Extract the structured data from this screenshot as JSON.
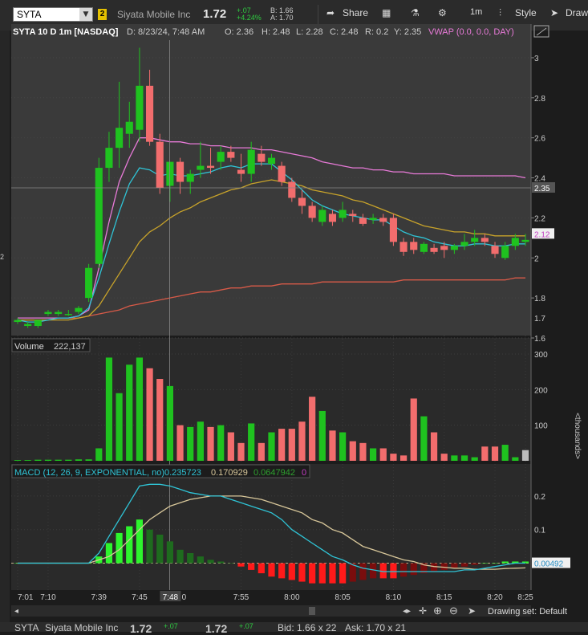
{
  "topbar": {
    "symbol": "SYTA",
    "link_number": "2",
    "company": "Siyata Mobile Inc",
    "last": "1.72",
    "net_change": "+.07",
    "pct_change": "+4.24%",
    "bid": "B: 1.66",
    "ask": "A: 1.70",
    "share_label": "Share",
    "interval_label": "1m",
    "style_label": "Style",
    "drawings_label": "Drawings"
  },
  "header": {
    "title": "SYTA 10 D 1m [NASDAQ]",
    "date": "D: 8/23/24, 7:48 AM",
    "open": "O: 2.36",
    "high": "H: 2.48",
    "low": "L: 2.28",
    "close": "C: 2.48",
    "range": "R: 0.2",
    "y": "Y: 2.35",
    "vwap": "VWAP (0.0, 0.0, DAY)"
  },
  "volume_header": {
    "label": "Volume",
    "value": "222,137"
  },
  "macd_header": {
    "label": "MACD (12, 26, 9, EXPONENTIAL, no)",
    "value": "0.235723",
    "avg": "0.170929",
    "diff": "0.0647942",
    "zero": "0"
  },
  "price_axis": {
    "ticks": [
      "3",
      "2.8",
      "2.6",
      "2.4",
      "2.2",
      "2",
      "1.8",
      "1.6"
    ],
    "cursor_label": "2.35",
    "last_label": "2.12",
    "low_label": "1.7",
    "left_tick": "2"
  },
  "volume_axis": {
    "ticks": [
      "300",
      "200",
      "100"
    ],
    "unit": "<thousands>"
  },
  "macd_axis": {
    "ticks": [
      "0.2",
      "0.1"
    ],
    "value_label": "0.00492"
  },
  "time_axis": {
    "ticks": [
      "7:01",
      "7:10",
      "7:39",
      "7:45",
      "7:55",
      "8:00",
      "8:05",
      "8:10",
      "8:15",
      "8:20",
      "8:25"
    ],
    "cursor_label": "7:48",
    "cursor_tail": "0"
  },
  "bottom": {
    "drawing_set": "Drawing set: Default"
  },
  "footer": {
    "symbol": "SYTA",
    "company": "Siyata Mobile Inc",
    "last": "1.72",
    "change": "+.07",
    "last2": "1.72",
    "change2": "+.07",
    "bid": "Bid: 1.66 x 22",
    "ask": "Ask: 1.70 x 21"
  },
  "colors": {
    "up": "#1fc21f",
    "down": "#f26d6d",
    "vwap": "#e87ad8",
    "ema_fast": "#2fc4d6",
    "ema_mid": "#c8a32a",
    "ema_slow": "#d85a48",
    "macd": "#2fc4d6",
    "macd_avg": "#d8c79a"
  },
  "chart_data": {
    "type": "candlestick",
    "title": "SYTA 10 D 1m [NASDAQ]",
    "ylim": [
      1.6,
      3.1
    ],
    "candles": [
      {
        "t": "7:01",
        "o": 1.68,
        "h": 1.7,
        "l": 1.67,
        "c": 1.69
      },
      {
        "t": "7:36",
        "o": 1.66,
        "h": 1.68,
        "l": 1.65,
        "c": 1.67
      },
      {
        "t": "7:37",
        "o": 1.66,
        "h": 1.69,
        "l": 1.65,
        "c": 1.69
      },
      {
        "t": "7:38",
        "o": 1.72,
        "h": 1.74,
        "l": 1.71,
        "c": 1.73
      },
      {
        "t": "7:39",
        "o": 1.72,
        "h": 1.74,
        "l": 1.71,
        "c": 1.73
      },
      {
        "t": "7:40",
        "o": 1.72,
        "h": 1.74,
        "l": 1.71,
        "c": 1.72
      },
      {
        "t": "7:41",
        "o": 1.73,
        "h": 1.76,
        "l": 1.72,
        "c": 1.75
      },
      {
        "t": "7:42",
        "o": 1.8,
        "h": 1.97,
        "l": 1.78,
        "c": 1.95
      },
      {
        "t": "7:43",
        "o": 1.97,
        "h": 2.5,
        "l": 1.95,
        "c": 2.45
      },
      {
        "t": "7:44",
        "o": 2.45,
        "h": 2.63,
        "l": 2.38,
        "c": 2.55
      },
      {
        "t": "7:45",
        "o": 2.55,
        "h": 2.88,
        "l": 2.45,
        "c": 2.65
      },
      {
        "t": "7:46",
        "o": 2.62,
        "h": 2.78,
        "l": 2.55,
        "c": 2.68
      },
      {
        "t": "7:47",
        "o": 2.64,
        "h": 3.05,
        "l": 2.58,
        "c": 2.86
      },
      {
        "t": "7:48",
        "o": 2.86,
        "h": 2.94,
        "l": 2.56,
        "c": 2.58
      },
      {
        "t": "7:49",
        "o": 2.58,
        "h": 2.62,
        "l": 2.32,
        "c": 2.35
      },
      {
        "t": "7:50",
        "o": 2.36,
        "h": 2.48,
        "l": 2.28,
        "c": 2.48
      },
      {
        "t": "7:51",
        "o": 2.48,
        "h": 2.5,
        "l": 2.32,
        "c": 2.38
      },
      {
        "t": "7:52",
        "o": 2.38,
        "h": 2.44,
        "l": 2.32,
        "c": 2.42
      },
      {
        "t": "7:53",
        "o": 2.44,
        "h": 2.58,
        "l": 2.4,
        "c": 2.46
      },
      {
        "t": "7:54",
        "o": 2.46,
        "h": 2.55,
        "l": 2.42,
        "c": 2.45
      },
      {
        "t": "7:55",
        "o": 2.48,
        "h": 2.56,
        "l": 2.44,
        "c": 2.53
      },
      {
        "t": "7:56",
        "o": 2.53,
        "h": 2.56,
        "l": 2.48,
        "c": 2.5
      },
      {
        "t": "7:57",
        "o": 2.44,
        "h": 2.52,
        "l": 2.38,
        "c": 2.42
      },
      {
        "t": "7:58",
        "o": 2.42,
        "h": 2.58,
        "l": 2.38,
        "c": 2.54
      },
      {
        "t": "7:59",
        "o": 2.52,
        "h": 2.56,
        "l": 2.46,
        "c": 2.48
      },
      {
        "t": "8:00",
        "o": 2.47,
        "h": 2.52,
        "l": 2.44,
        "c": 2.5
      },
      {
        "t": "8:01",
        "o": 2.46,
        "h": 2.48,
        "l": 2.36,
        "c": 2.38
      },
      {
        "t": "8:02",
        "o": 2.38,
        "h": 2.4,
        "l": 2.28,
        "c": 2.3
      },
      {
        "t": "8:03",
        "o": 2.3,
        "h": 2.34,
        "l": 2.22,
        "c": 2.26
      },
      {
        "t": "8:04",
        "o": 2.26,
        "h": 2.28,
        "l": 2.18,
        "c": 2.2
      },
      {
        "t": "8:05",
        "o": 2.18,
        "h": 2.26,
        "l": 2.16,
        "c": 2.24
      },
      {
        "t": "8:06",
        "o": 2.22,
        "h": 2.24,
        "l": 2.16,
        "c": 2.18
      },
      {
        "t": "8:07",
        "o": 2.2,
        "h": 2.28,
        "l": 2.18,
        "c": 2.24
      },
      {
        "t": "8:08",
        "o": 2.22,
        "h": 2.24,
        "l": 2.18,
        "c": 2.21
      },
      {
        "t": "8:09",
        "o": 2.2,
        "h": 2.22,
        "l": 2.16,
        "c": 2.17
      },
      {
        "t": "8:10",
        "o": 2.19,
        "h": 2.22,
        "l": 2.17,
        "c": 2.2
      },
      {
        "t": "8:11",
        "o": 2.2,
        "h": 2.22,
        "l": 2.16,
        "c": 2.18
      },
      {
        "t": "8:12",
        "o": 2.2,
        "h": 2.22,
        "l": 2.06,
        "c": 2.08
      },
      {
        "t": "8:13",
        "o": 2.08,
        "h": 2.1,
        "l": 2.01,
        "c": 2.03
      },
      {
        "t": "8:14",
        "o": 2.08,
        "h": 2.1,
        "l": 2.02,
        "c": 2.04
      },
      {
        "t": "8:15",
        "o": 2.03,
        "h": 2.08,
        "l": 2.02,
        "c": 2.07
      },
      {
        "t": "8:16",
        "o": 2.05,
        "h": 2.07,
        "l": 2.02,
        "c": 2.03
      },
      {
        "t": "8:17",
        "o": 2.06,
        "h": 2.08,
        "l": 2.0,
        "c": 2.04
      },
      {
        "t": "8:18",
        "o": 2.04,
        "h": 2.07,
        "l": 2.02,
        "c": 2.06
      },
      {
        "t": "8:19",
        "o": 2.06,
        "h": 2.12,
        "l": 2.04,
        "c": 2.08
      },
      {
        "t": "8:20",
        "o": 2.08,
        "h": 2.14,
        "l": 2.06,
        "c": 2.1
      },
      {
        "t": "8:21",
        "o": 2.1,
        "h": 2.12,
        "l": 2.06,
        "c": 2.08
      },
      {
        "t": "8:22",
        "o": 2.06,
        "h": 2.08,
        "l": 2.0,
        "c": 2.02
      },
      {
        "t": "8:23",
        "o": 2.0,
        "h": 2.08,
        "l": 1.99,
        "c": 2.06
      },
      {
        "t": "8:24",
        "o": 2.06,
        "h": 2.12,
        "l": 2.04,
        "c": 2.1
      },
      {
        "t": "8:25",
        "o": 2.08,
        "h": 2.12,
        "l": 2.06,
        "c": 2.09
      }
    ],
    "vwap": [
      1.7,
      1.7,
      1.7,
      1.7,
      1.7,
      1.7,
      1.71,
      1.74,
      1.95,
      2.18,
      2.38,
      2.5,
      2.6,
      2.6,
      2.59,
      2.58,
      2.58,
      2.57,
      2.57,
      2.56,
      2.56,
      2.55,
      2.55,
      2.55,
      2.54,
      2.54,
      2.53,
      2.52,
      2.51,
      2.5,
      2.48,
      2.47,
      2.46,
      2.45,
      2.45,
      2.44,
      2.44,
      2.43,
      2.43,
      2.42,
      2.42,
      2.42,
      2.42,
      2.41,
      2.41,
      2.41,
      2.41,
      2.41,
      2.41,
      2.41,
      2.4
    ],
    "ema_fast": [
      1.69,
      1.68,
      1.68,
      1.69,
      1.7,
      1.7,
      1.71,
      1.75,
      1.9,
      2.07,
      2.23,
      2.37,
      2.45,
      2.44,
      2.41,
      2.42,
      2.41,
      2.41,
      2.42,
      2.43,
      2.45,
      2.46,
      2.45,
      2.47,
      2.47,
      2.47,
      2.43,
      2.39,
      2.34,
      2.29,
      2.26,
      2.24,
      2.22,
      2.21,
      2.2,
      2.19,
      2.19,
      2.16,
      2.13,
      2.11,
      2.1,
      2.08,
      2.07,
      2.06,
      2.06,
      2.07,
      2.07,
      2.06,
      2.06,
      2.07,
      2.07
    ],
    "ema_mid": [
      1.69,
      1.69,
      1.69,
      1.69,
      1.69,
      1.69,
      1.7,
      1.71,
      1.76,
      1.84,
      1.92,
      2.0,
      2.08,
      2.13,
      2.16,
      2.2,
      2.23,
      2.25,
      2.28,
      2.3,
      2.32,
      2.34,
      2.35,
      2.37,
      2.38,
      2.39,
      2.38,
      2.37,
      2.36,
      2.34,
      2.33,
      2.32,
      2.31,
      2.29,
      2.28,
      2.26,
      2.24,
      2.22,
      2.2,
      2.18,
      2.16,
      2.15,
      2.14,
      2.13,
      2.13,
      2.12,
      2.12,
      2.11,
      2.11,
      2.11,
      2.11
    ],
    "ema_slow": [
      1.69,
      1.69,
      1.69,
      1.69,
      1.7,
      1.7,
      1.7,
      1.71,
      1.72,
      1.73,
      1.74,
      1.76,
      1.77,
      1.78,
      1.79,
      1.8,
      1.81,
      1.82,
      1.83,
      1.83,
      1.84,
      1.85,
      1.85,
      1.86,
      1.86,
      1.86,
      1.87,
      1.87,
      1.87,
      1.87,
      1.88,
      1.88,
      1.88,
      1.88,
      1.88,
      1.88,
      1.88,
      1.88,
      1.89,
      1.89,
      1.89,
      1.89,
      1.89,
      1.89,
      1.89,
      1.89,
      1.89,
      1.89,
      1.89,
      1.9,
      1.9
    ],
    "volume": [
      2,
      2,
      3,
      3,
      3,
      3,
      4,
      4,
      35,
      290,
      190,
      270,
      290,
      260,
      230,
      210,
      100,
      95,
      110,
      95,
      100,
      80,
      50,
      105,
      50,
      80,
      90,
      90,
      110,
      180,
      140,
      85,
      80,
      55,
      50,
      35,
      35,
      20,
      15,
      175,
      125,
      80,
      20,
      15,
      15,
      10,
      40,
      40,
      45,
      10,
      30
    ],
    "volume_ylim": [
      0,
      300
    ],
    "macd": [
      0.0,
      0.0,
      0.0,
      0.0,
      0.0,
      0.0,
      0.0,
      0.0,
      0.03,
      0.08,
      0.13,
      0.18,
      0.23,
      0.235,
      0.235,
      0.23,
      0.22,
      0.21,
      0.205,
      0.2,
      0.2,
      0.19,
      0.18,
      0.17,
      0.16,
      0.15,
      0.13,
      0.1,
      0.08,
      0.06,
      0.04,
      0.02,
      0.01,
      -0.005,
      -0.015,
      -0.02,
      -0.025,
      -0.025,
      -0.025,
      -0.025,
      -0.025,
      -0.025,
      -0.025,
      -0.025,
      -0.02,
      -0.02,
      -0.015,
      -0.01,
      -0.005,
      0.0,
      0.0
    ],
    "macd_avg": [
      0.0,
      0.0,
      0.0,
      0.0,
      0.0,
      0.0,
      0.0,
      0.0,
      0.01,
      0.02,
      0.04,
      0.07,
      0.1,
      0.13,
      0.15,
      0.17,
      0.18,
      0.19,
      0.195,
      0.2,
      0.2,
      0.2,
      0.2,
      0.195,
      0.19,
      0.18,
      0.17,
      0.16,
      0.15,
      0.13,
      0.12,
      0.1,
      0.09,
      0.07,
      0.05,
      0.04,
      0.03,
      0.02,
      0.01,
      0.005,
      -0.005,
      -0.01,
      -0.012,
      -0.015,
      -0.015,
      -0.018,
      -0.018,
      -0.018,
      -0.016,
      -0.015,
      -0.014
    ],
    "macd_hist": [
      0.0,
      0.0,
      0.0,
      0.0,
      0.0,
      0.0,
      0.0,
      0.0,
      0.02,
      0.06,
      0.09,
      0.11,
      0.13,
      0.1,
      0.085,
      0.065,
      0.04,
      0.03,
      0.02,
      0.01,
      0.005,
      0.0,
      -0.01,
      -0.02,
      -0.03,
      -0.04,
      -0.045,
      -0.05,
      -0.055,
      -0.06,
      -0.06,
      -0.06,
      -0.06,
      -0.055,
      -0.05,
      -0.045,
      -0.045,
      -0.045,
      -0.04,
      -0.035,
      -0.03,
      -0.025,
      -0.02,
      -0.015,
      -0.01,
      -0.005,
      0.0,
      0.0,
      0.005,
      0.005,
      0.005
    ],
    "macd_ylim": [
      -0.08,
      0.25
    ]
  }
}
